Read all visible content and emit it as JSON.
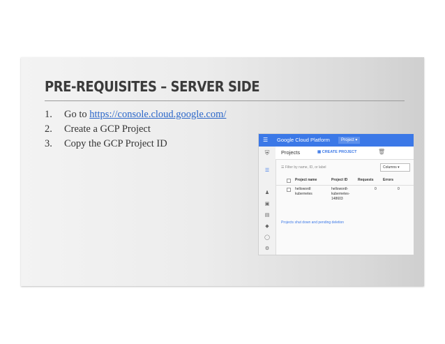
{
  "slide": {
    "title": "PRE-REQUISITES – SERVER SIDE",
    "steps": [
      {
        "num": "1.",
        "pre": "Go to ",
        "link": "https://console.cloud.google.com/"
      },
      {
        "num": "2.",
        "text": "Create a GCP Project"
      },
      {
        "num": "3.",
        "text": "Copy the GCP Project ID"
      }
    ]
  },
  "console": {
    "brand": "Google Cloud Platform",
    "project_selector": "Project ▾",
    "page_title": "Projects",
    "create_label": "CREATE PROJECT",
    "filter_placeholder": "Filter by name, ID, or label",
    "dropdown": "Columns ▾",
    "columns": [
      "Project name",
      "Project ID",
      "Requests",
      "Errors"
    ],
    "row": {
      "name_line1": "hellowordl",
      "name_line2": "kubernetes",
      "id_line1": "hellowordl-",
      "id_line2": "kubernetes-",
      "id_line3": "148603",
      "requests": "0",
      "errors": "0"
    },
    "link": "Projects shut down and pending deletion"
  },
  "colors": {
    "accent": "#3b78e7",
    "link": "#2a66c9",
    "title": "#3b3b3b"
  }
}
